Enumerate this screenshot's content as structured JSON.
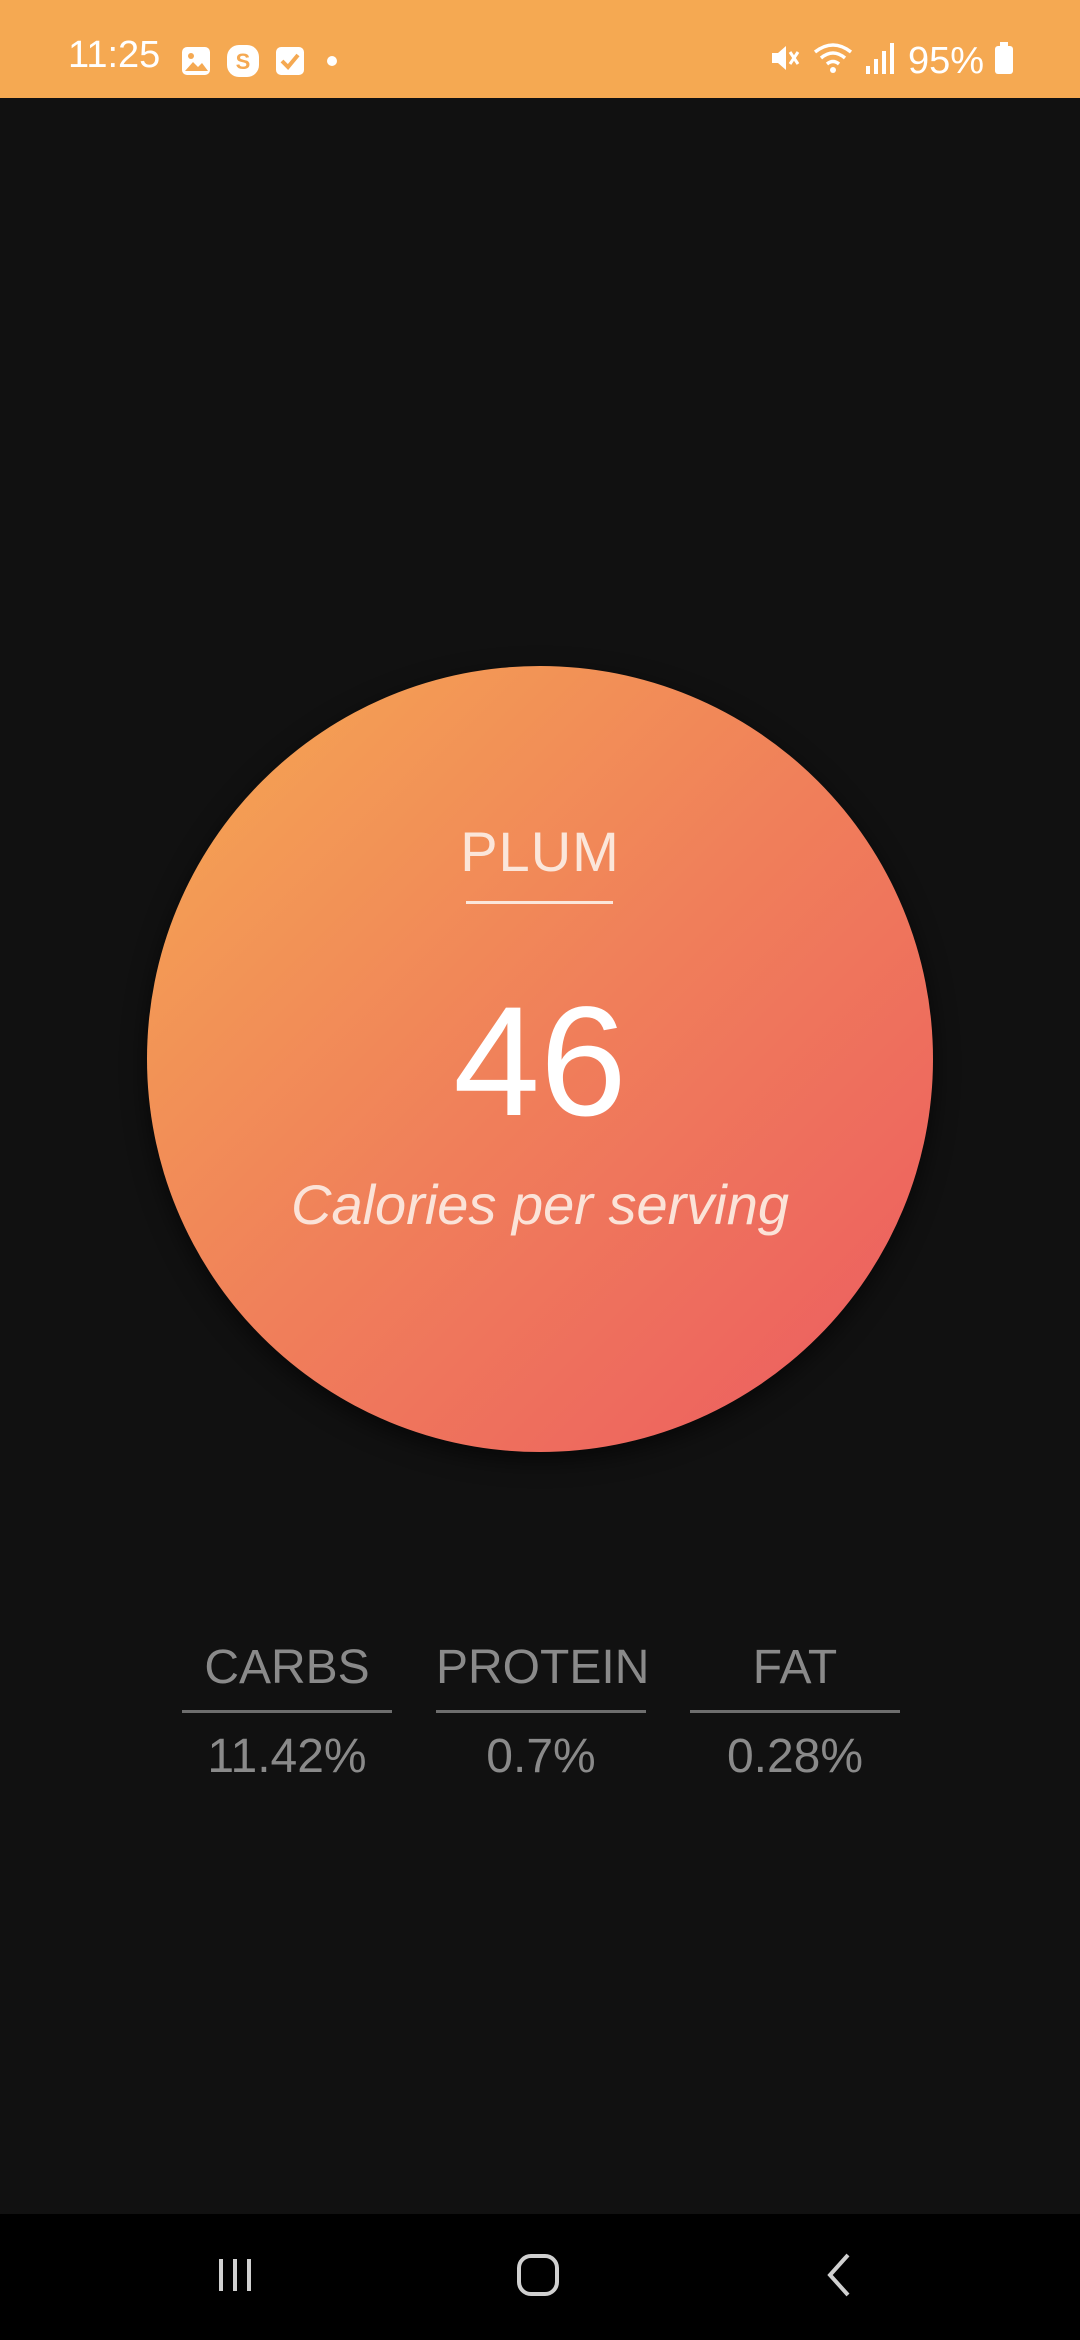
{
  "status_bar": {
    "time": "11:25",
    "battery_percent": "95%",
    "bg_color": "#f5a952",
    "left_icons": [
      "image-icon",
      "s-app-icon",
      "checkbox-icon",
      "dot-icon"
    ],
    "right_icons": [
      "mute-icon",
      "wifi-icon",
      "signal-icon",
      "battery-icon"
    ]
  },
  "food": {
    "name": "PLUM",
    "calories": "46",
    "calories_label": "Calories per serving",
    "gradient": [
      "#f5a952",
      "#ec5a61"
    ]
  },
  "macros": [
    {
      "label": "CARBS",
      "value": "11.42%"
    },
    {
      "label": "PROTEIN",
      "value": "0.7%"
    },
    {
      "label": "FAT",
      "value": "0.28%"
    }
  ],
  "nav_bar": {
    "buttons": [
      "recents-icon",
      "home-icon",
      "back-icon"
    ]
  }
}
